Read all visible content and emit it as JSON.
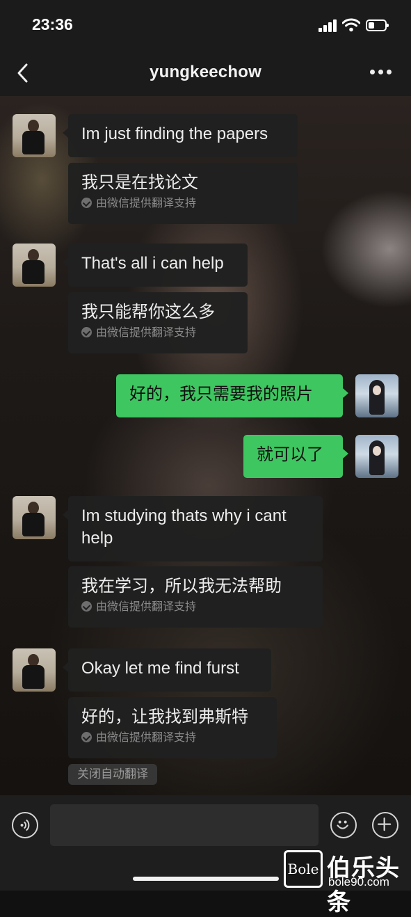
{
  "status_bar": {
    "time": "23:36"
  },
  "header": {
    "title": "yungkeechow"
  },
  "messages": [
    {
      "sender": "other",
      "text": "Im just finding the papers",
      "translation": "我只是在找论文",
      "translation_credit": "由微信提供翻译支持"
    },
    {
      "sender": "other",
      "text": "That's all i can help",
      "translation": "我只能帮你这么多",
      "translation_credit": "由微信提供翻译支持"
    },
    {
      "sender": "me",
      "text": "好的，我只需要我的照片"
    },
    {
      "sender": "me",
      "text": "就可以了"
    },
    {
      "sender": "other",
      "text": "Im studying thats why i cant help",
      "translation": "我在学习，所以我无法帮助",
      "translation_credit": "由微信提供翻译支持"
    },
    {
      "sender": "other",
      "text": "Okay let me find furst",
      "translation": "好的，让我找到弗斯特",
      "translation_credit": "由微信提供翻译支持"
    }
  ],
  "auto_translate_toggle": "关闭自动翻译",
  "input_bar": {
    "voice_icon": "voice-icon",
    "emoji_icon": "emoji-icon",
    "add_icon": "add-icon"
  },
  "watermark": {
    "logo_text": "Bole",
    "name": "伯乐头条",
    "url": "bole90.com"
  },
  "colors": {
    "my_bubble": "#3ec660",
    "other_bubble": "#202020",
    "bar_bg": "#1b1b1b"
  }
}
